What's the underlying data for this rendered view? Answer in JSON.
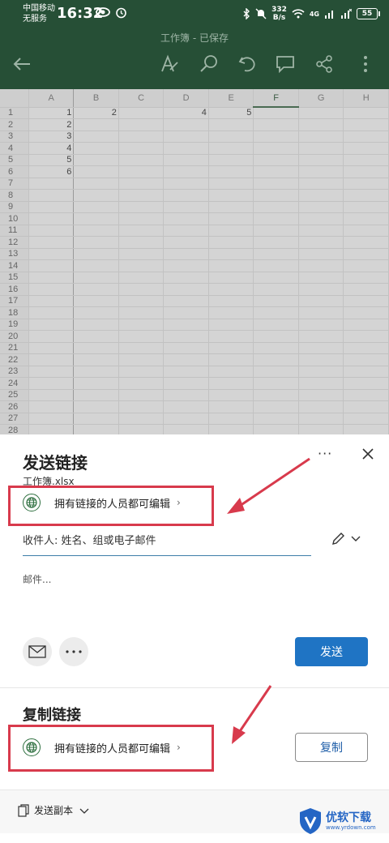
{
  "status_bar": {
    "carrier_line1": "中国移动",
    "carrier_line2": "无服务",
    "time": "16:32",
    "speed_value": "332",
    "speed_unit": "B/s",
    "network": "4G",
    "battery": "55"
  },
  "header": {
    "doc_title": "工作簿 - 已保存",
    "tools": [
      "back-arrow-icon",
      "pen-icon",
      "search-icon",
      "undo-icon",
      "comment-icon",
      "share-icon",
      "more-vertical-icon"
    ]
  },
  "sheet": {
    "columns": [
      "A",
      "B",
      "C",
      "D",
      "E",
      "F",
      "G",
      "H"
    ],
    "selected_column": "F",
    "rows": [
      "1",
      "2",
      "3",
      "4",
      "5",
      "6",
      "7",
      "8",
      "9",
      "10",
      "11",
      "12",
      "13",
      "14",
      "15",
      "16",
      "17",
      "18",
      "19",
      "20",
      "21",
      "22",
      "23",
      "24",
      "25",
      "26",
      "27",
      "28"
    ],
    "cells": {
      "A": [
        "1",
        "2",
        "3",
        "4",
        "5",
        "6"
      ],
      "B1": "2",
      "D1": "4",
      "E1": "5"
    }
  },
  "send_link": {
    "title": "发送链接",
    "file_name": "工作簿.xlsx",
    "more_label": "···",
    "permission": "拥有链接的人员都可编辑",
    "to_placeholder": "收件人: 姓名、组或电子邮件",
    "message_placeholder": "邮件...",
    "send_label": "发送"
  },
  "copy_link": {
    "title": "复制链接",
    "permission": "拥有链接的人员都可编辑",
    "copy_label": "复制"
  },
  "footer": {
    "send_copy_label": "发送副本"
  },
  "watermark": {
    "name": "优软下载",
    "url": "www.yrdown.com"
  },
  "colors": {
    "header_bg": "#264f36",
    "primary_button": "#1f74c4",
    "highlight_red": "#d83a4c",
    "globe_green": "#2c6e3e"
  }
}
